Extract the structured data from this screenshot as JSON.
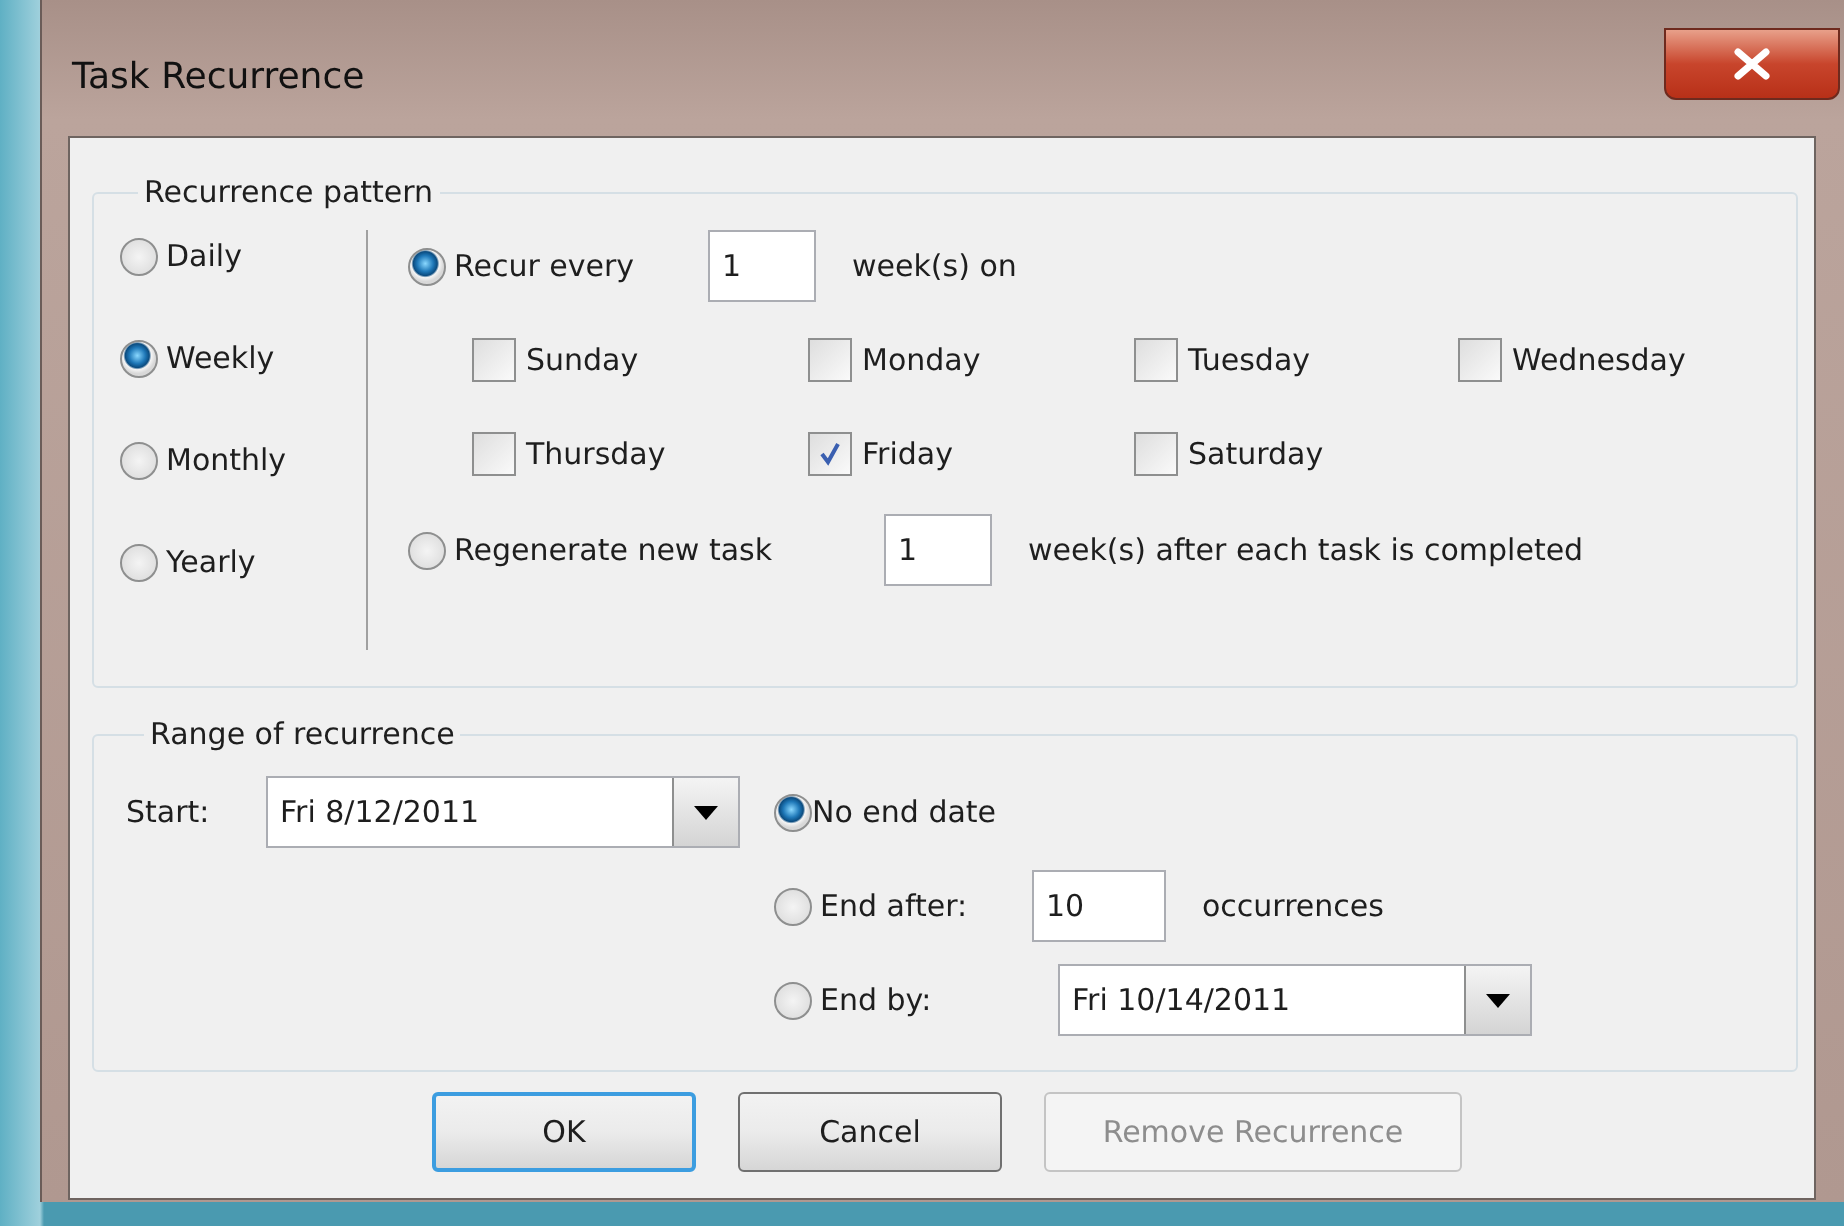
{
  "window": {
    "title": "Task Recurrence"
  },
  "pattern": {
    "label": "Recurrence pattern",
    "frequencies": [
      {
        "label": "Daily",
        "selected": false
      },
      {
        "label": "Weekly",
        "selected": true
      },
      {
        "label": "Monthly",
        "selected": false
      },
      {
        "label": "Yearly",
        "selected": false
      }
    ],
    "recur_every": {
      "label": "Recur every",
      "selected": true,
      "value": "1",
      "suffix": "week(s) on"
    },
    "days": [
      {
        "label": "Sunday",
        "checked": false
      },
      {
        "label": "Monday",
        "checked": false
      },
      {
        "label": "Tuesday",
        "checked": false
      },
      {
        "label": "Wednesday",
        "checked": false
      },
      {
        "label": "Thursday",
        "checked": false
      },
      {
        "label": "Friday",
        "checked": true
      },
      {
        "label": "Saturday",
        "checked": false
      }
    ],
    "regenerate": {
      "label": "Regenerate new task",
      "selected": false,
      "value": "1",
      "suffix": "week(s) after each task is completed"
    }
  },
  "range": {
    "label": "Range of recurrence",
    "start_label": "Start:",
    "start_value": "Fri 8/12/2011",
    "end_options": [
      {
        "kind": "none",
        "label": "No end date",
        "selected": true
      },
      {
        "kind": "after",
        "label": "End after:",
        "selected": false,
        "value": "10",
        "suffix": "occurrences"
      },
      {
        "kind": "by",
        "label": "End by:",
        "selected": false,
        "value": "Fri 10/14/2011"
      }
    ]
  },
  "buttons": [
    {
      "label": "OK",
      "default": true,
      "disabled": false
    },
    {
      "label": "Cancel",
      "default": false,
      "disabled": false
    },
    {
      "label": "Remove Recurrence",
      "default": false,
      "disabled": true
    }
  ]
}
